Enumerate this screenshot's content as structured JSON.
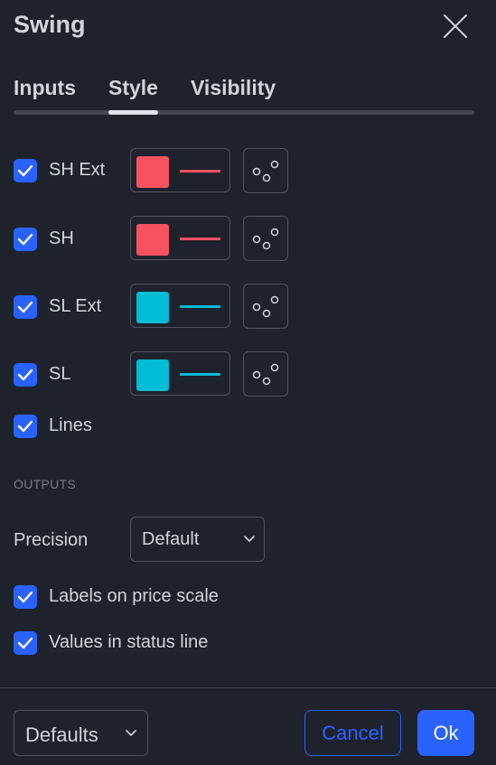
{
  "dialog": {
    "title": "Swing"
  },
  "tabs": [
    {
      "label": "Inputs",
      "active": false
    },
    {
      "label": "Style",
      "active": true
    },
    {
      "label": "Visibility",
      "active": false
    }
  ],
  "style_rows": [
    {
      "label": "SH Ext",
      "checked": true,
      "color": "#f7525f"
    },
    {
      "label": "SH",
      "checked": true,
      "color": "#f7525f"
    },
    {
      "label": "SL Ext",
      "checked": true,
      "color": "#00bcd4"
    },
    {
      "label": "SL",
      "checked": true,
      "color": "#00bcd4"
    }
  ],
  "lines": {
    "label": "Lines",
    "checked": true
  },
  "outputs": {
    "section_label": "OUTPUTS",
    "precision_label": "Precision",
    "precision_value": "Default",
    "labels_on_price_scale": {
      "label": "Labels on price scale",
      "checked": true
    },
    "values_in_status_line": {
      "label": "Values in status line",
      "checked": true
    }
  },
  "footer": {
    "defaults_label": "Defaults",
    "cancel_label": "Cancel",
    "ok_label": "Ok"
  },
  "icons": {
    "close": "close-icon",
    "check": "checkmark-icon",
    "line_style": "dots-style-icon",
    "dropdown": "chevron-down-icon"
  },
  "colors": {
    "background": "#1e222d",
    "accent": "#2962ff",
    "text": "#d1d4dc",
    "muted": "#787b86",
    "border": "#50535e"
  }
}
